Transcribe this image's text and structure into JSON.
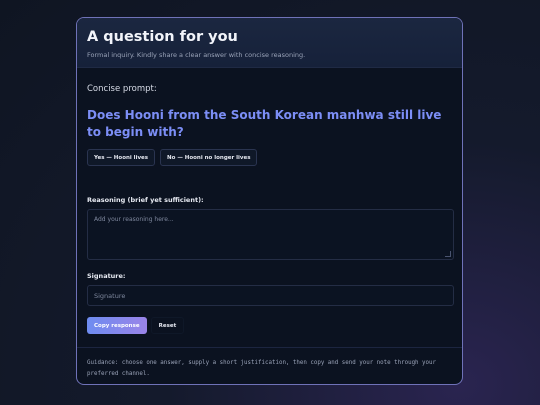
{
  "header": {
    "title": "A question for you",
    "subtitle": "Formal inquiry. Kindly share a clear answer with concise reasoning."
  },
  "prompt": {
    "label": "Concise prompt:",
    "question": "Does Hooni from the South Korean manhwa still live to begin with?"
  },
  "choices": {
    "yes": "Yes — Hooni lives",
    "no": "No — Hooni no longer lives"
  },
  "reasoning": {
    "label": "Reasoning (brief yet sufficient):",
    "placeholder": "Add your reasoning here..."
  },
  "signature": {
    "label": "Signature:",
    "placeholder": "Signature"
  },
  "actions": {
    "copy": "Copy response",
    "reset": "Reset"
  },
  "guidance": "Guidance: choose one answer, supply a short justification, then copy and send your note through your preferred channel."
}
